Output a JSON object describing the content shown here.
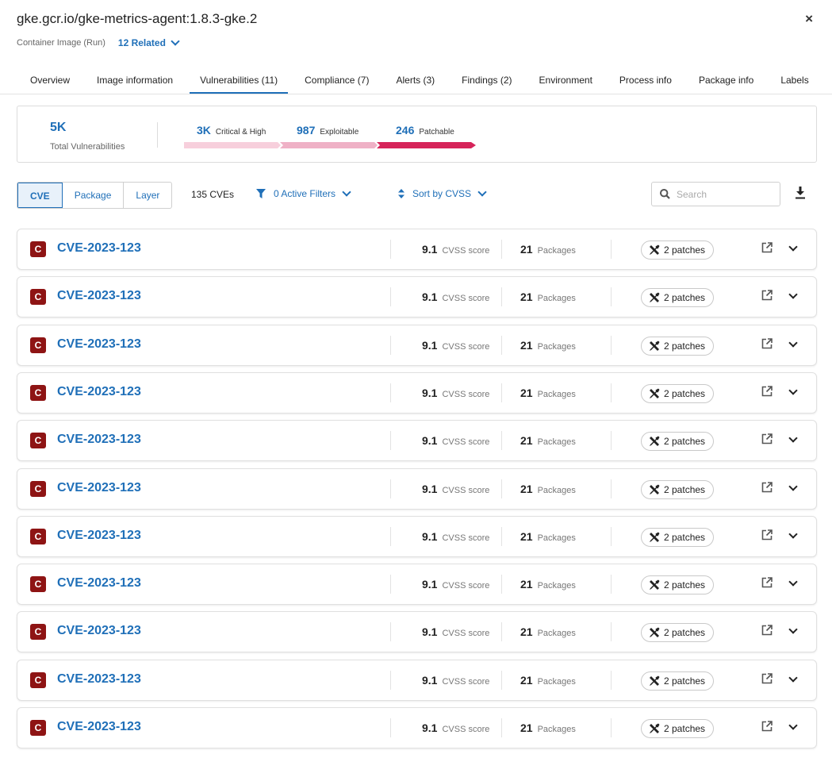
{
  "header": {
    "title": "gke.gcr.io/gke-metrics-agent:1.8.3-gke.2",
    "subtitle": "Container Image (Run)",
    "related": "12 Related",
    "close_icon": "×"
  },
  "tabs": [
    {
      "label": "Overview"
    },
    {
      "label": "Image information"
    },
    {
      "label": "Vulnerabilities (11)",
      "active": true
    },
    {
      "label": "Compliance (7)"
    },
    {
      "label": "Alerts (3)"
    },
    {
      "label": "Findings (2)"
    },
    {
      "label": "Environment"
    },
    {
      "label": "Process info"
    },
    {
      "label": "Package info"
    },
    {
      "label": "Labels"
    }
  ],
  "summary": {
    "total_value": "5K",
    "total_label": "Total Vulnerabilities",
    "segments": [
      {
        "value": "3K",
        "label": "Critical & High",
        "color": "#f7cfdc"
      },
      {
        "value": "987",
        "label": "Exploitable",
        "color": "#efb1c6"
      },
      {
        "value": "246",
        "label": "Patchable",
        "color": "#d6245a"
      }
    ]
  },
  "toolbar": {
    "views": [
      {
        "label": "CVE",
        "active": true
      },
      {
        "label": "Package"
      },
      {
        "label": "Layer"
      }
    ],
    "count": "135 CVEs",
    "filters": "0 Active Filters",
    "sort": "Sort by CVSS",
    "search_placeholder": "Search"
  },
  "rows": [
    {
      "badge": "C",
      "cve": "CVE-2023-123",
      "score": "9.1",
      "score_label": "CVSS score",
      "packages": "21",
      "packages_label": "Packages",
      "patches": "2 patches"
    },
    {
      "badge": "C",
      "cve": "CVE-2023-123",
      "score": "9.1",
      "score_label": "CVSS score",
      "packages": "21",
      "packages_label": "Packages",
      "patches": "2 patches"
    },
    {
      "badge": "C",
      "cve": "CVE-2023-123",
      "score": "9.1",
      "score_label": "CVSS score",
      "packages": "21",
      "packages_label": "Packages",
      "patches": "2 patches"
    },
    {
      "badge": "C",
      "cve": "CVE-2023-123",
      "score": "9.1",
      "score_label": "CVSS score",
      "packages": "21",
      "packages_label": "Packages",
      "patches": "2 patches"
    },
    {
      "badge": "C",
      "cve": "CVE-2023-123",
      "score": "9.1",
      "score_label": "CVSS score",
      "packages": "21",
      "packages_label": "Packages",
      "patches": "2 patches"
    },
    {
      "badge": "C",
      "cve": "CVE-2023-123",
      "score": "9.1",
      "score_label": "CVSS score",
      "packages": "21",
      "packages_label": "Packages",
      "patches": "2 patches"
    },
    {
      "badge": "C",
      "cve": "CVE-2023-123",
      "score": "9.1",
      "score_label": "CVSS score",
      "packages": "21",
      "packages_label": "Packages",
      "patches": "2 patches"
    },
    {
      "badge": "C",
      "cve": "CVE-2023-123",
      "score": "9.1",
      "score_label": "CVSS score",
      "packages": "21",
      "packages_label": "Packages",
      "patches": "2 patches"
    },
    {
      "badge": "C",
      "cve": "CVE-2023-123",
      "score": "9.1",
      "score_label": "CVSS score",
      "packages": "21",
      "packages_label": "Packages",
      "patches": "2 patches"
    },
    {
      "badge": "C",
      "cve": "CVE-2023-123",
      "score": "9.1",
      "score_label": "CVSS score",
      "packages": "21",
      "packages_label": "Packages",
      "patches": "2 patches"
    },
    {
      "badge": "C",
      "cve": "CVE-2023-123",
      "score": "9.1",
      "score_label": "CVSS score",
      "packages": "21",
      "packages_label": "Packages",
      "patches": "2 patches"
    }
  ]
}
